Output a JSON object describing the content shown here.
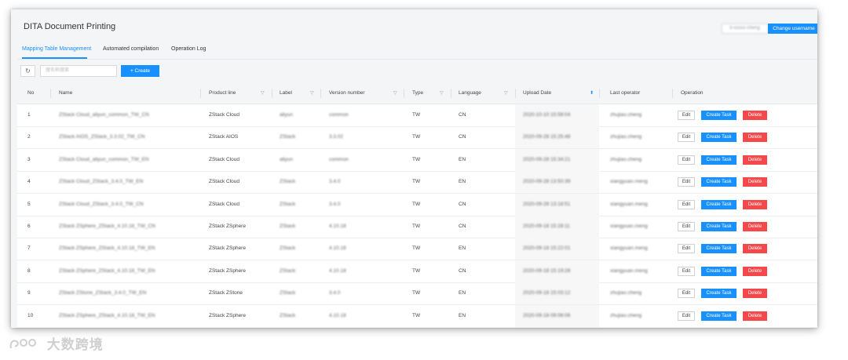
{
  "app": {
    "title": "DITA Document Printing"
  },
  "header": {
    "username": "ti-xxxxx-cheng",
    "change_username_label": "Change username"
  },
  "tabs": [
    {
      "label": "Mapping Table Management",
      "active": true
    },
    {
      "label": "Automated compilation",
      "active": false
    },
    {
      "label": "Operation Log",
      "active": false
    }
  ],
  "toolbar": {
    "refresh_icon": "refresh-icon",
    "search_placeholder": "搜名称搜索",
    "create_label": "+   Create"
  },
  "table": {
    "columns": [
      "No",
      "Name",
      "Product line",
      "Label",
      "Version number",
      "Type",
      "Language",
      "Upload Date",
      "Last operator",
      "Operation"
    ],
    "actions": {
      "edit": "Edit",
      "create_task": "Create Task",
      "delete": "Delete"
    },
    "rows": [
      {
        "no": "1",
        "name": "ZStack Cloud_aliyun_common_TW_CN",
        "product": "ZStack Cloud",
        "label": "aliyun",
        "version": "common",
        "type": "TW",
        "language": "CN",
        "date": "2020-10-10 15:58:04",
        "operator": "zhujiao.cheng"
      },
      {
        "no": "2",
        "name": "ZStack AIOS_ZStack_3.3.02_TW_CN",
        "product": "ZStack AIOS",
        "label": "ZStack",
        "version": "3.3.02",
        "type": "TW",
        "language": "CN",
        "date": "2020-09-28 15:25:48",
        "operator": "zhujiao.cheng"
      },
      {
        "no": "3",
        "name": "ZStack Cloud_aliyun_common_TW_EN",
        "product": "ZStack Cloud",
        "label": "aliyun",
        "version": "common",
        "type": "TW",
        "language": "EN",
        "date": "2020-09-28 15:34:21",
        "operator": "zhujiao.cheng"
      },
      {
        "no": "4",
        "name": "ZStack Cloud_ZStack_3.4.0_TW_EN",
        "product": "ZStack Cloud",
        "label": "ZStack",
        "version": "3.4.0",
        "type": "TW",
        "language": "EN",
        "date": "2020-09-28 13:50:39",
        "operator": "xiangyuan.meng"
      },
      {
        "no": "5",
        "name": "ZStack Cloud_ZStack_3.4.0_TW_CN",
        "product": "ZStack Cloud",
        "label": "ZStack",
        "version": "3.4.0",
        "type": "TW",
        "language": "CN",
        "date": "2020-09-28 13:18:51",
        "operator": "xiangyuan.meng"
      },
      {
        "no": "6",
        "name": "ZStack ZSphere_ZStack_4.10.18_TW_CN",
        "product": "ZStack ZSphere",
        "label": "ZStack",
        "version": "4.10.18",
        "type": "TW",
        "language": "CN",
        "date": "2020-09-18 15:28:11",
        "operator": "xiangyuan.meng"
      },
      {
        "no": "7",
        "name": "ZStack ZSphere_ZStack_4.10.18_TW_EN",
        "product": "ZStack ZSphere",
        "label": "ZStack",
        "version": "4.10.18",
        "type": "TW",
        "language": "EN",
        "date": "2020-09-18 15:22:01",
        "operator": "xiangyuan.meng"
      },
      {
        "no": "8",
        "name": "ZStack ZSphere_ZStack_4.10.18_TW_EN",
        "product": "ZStack ZSphere",
        "label": "ZStack",
        "version": "4.10.18",
        "type": "TW",
        "language": "CN",
        "date": "2020-09-18 15:19:28",
        "operator": "xiangyuan.meng"
      },
      {
        "no": "9",
        "name": "ZStack ZStone_ZStack_3.4.0_TW_EN",
        "product": "ZStack ZStone",
        "label": "ZStack",
        "version": "3.4.0",
        "type": "TW",
        "language": "EN",
        "date": "2020-09-18 15:03:12",
        "operator": "zhujiao.cheng"
      },
      {
        "no": "10",
        "name": "ZStack ZSphere_ZStack_4.10.18_TW_EN",
        "product": "ZStack ZSphere",
        "label": "ZStack",
        "version": "4.10.18",
        "type": "TW",
        "language": "EN",
        "date": "2020-09-18 09:06:06",
        "operator": "zhujiao.cheng"
      }
    ]
  },
  "watermark": {
    "text": "大数跨境"
  },
  "colors": {
    "primary": "#1890ff",
    "danger": "#f5484b",
    "bg": "#f4f5f7"
  }
}
